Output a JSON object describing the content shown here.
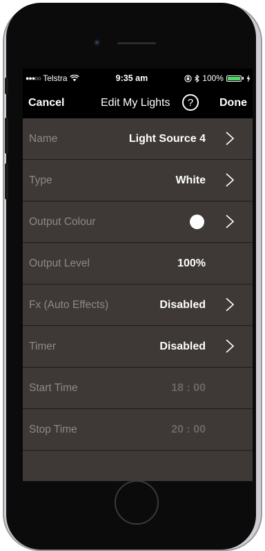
{
  "status_bar": {
    "carrier": "Telstra",
    "time": "9:35 am",
    "battery": "100%"
  },
  "nav": {
    "cancel": "Cancel",
    "title": "Edit My Lights",
    "help": "?",
    "done": "Done"
  },
  "rows": [
    {
      "label": "Name",
      "value": "Light Source 4",
      "chevron": true
    },
    {
      "label": "Type",
      "value": "White",
      "chevron": true
    },
    {
      "label": "Output Colour",
      "value": "",
      "swatch_color": "#ffffff",
      "chevron": true
    },
    {
      "label": "Output Level",
      "value": "100%",
      "chevron": false
    },
    {
      "label": "Fx (Auto Effects)",
      "value": "Disabled",
      "chevron": true
    },
    {
      "label": "Timer",
      "value": "Disabled",
      "chevron": true
    },
    {
      "label": "Start Time",
      "value": "18 : 00",
      "chevron": false
    },
    {
      "label": "Stop Time",
      "value": "20 : 00",
      "chevron": false
    }
  ],
  "colors": {
    "background": "#3e3936",
    "label": "#8e8986",
    "battery": "#4cd964"
  }
}
